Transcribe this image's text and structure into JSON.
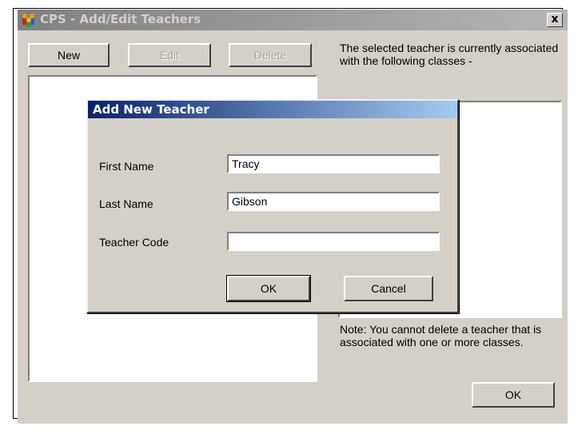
{
  "window": {
    "title": "CPS - Add/Edit Teachers",
    "close_label": "x",
    "toolbar": {
      "new_label": "New",
      "edit_label": "Edit",
      "delete_label": "Delete"
    },
    "info_text": "The selected teacher is currently associated with the following classes -",
    "note_text": "Note: You cannot delete a teacher that is associated with one or more classes.",
    "ok_label": "OK"
  },
  "dialog": {
    "title": "Add New Teacher",
    "fields": [
      {
        "label": "First Name",
        "value": "Tracy"
      },
      {
        "label": "Last Name",
        "value": "Gibson"
      },
      {
        "label": "Teacher Code",
        "value": ""
      }
    ],
    "ok_label": "OK",
    "cancel_label": "Cancel"
  },
  "colors": {
    "window_bg": "#d4d0c8",
    "active_title": "#0a246a",
    "inactive_title": "#808080"
  }
}
